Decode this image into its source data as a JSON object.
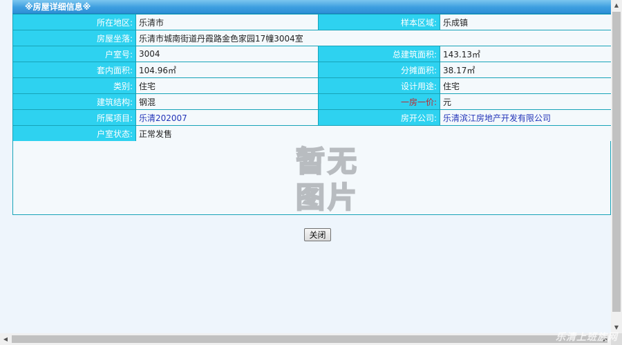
{
  "panel_title": "※房屋详细信息※",
  "rows": [
    {
      "label1": "所在地区:",
      "value1": "乐清市",
      "label2": "样本区域:",
      "value2": "乐成镇"
    },
    {
      "label1": "房屋坐落:",
      "value1": "乐清市城南街道丹霞路金色家园17幢3004室"
    },
    {
      "label1": "户室号:",
      "value1": "3004",
      "label2": "总建筑面积:",
      "value2": "143.13㎡"
    },
    {
      "label1": "套内面积:",
      "value1": "104.96㎡",
      "label2": "分摊面积:",
      "value2": "38.17㎡"
    },
    {
      "label1": "类别:",
      "value1": "住宅",
      "label2": "设计用途:",
      "value2": "住宅"
    },
    {
      "label1": "建筑结构:",
      "value1": "钢混",
      "label2": "一房一价:",
      "value2": "元"
    },
    {
      "label1": "所属项目:",
      "value1": "乐清202007",
      "label2": "房开公司:",
      "value2": "乐清滨江房地产开发有限公司"
    },
    {
      "label1": "户室状态:",
      "value1": "正常发售"
    }
  ],
  "no_image": {
    "line1": "暂无",
    "line2": "图片"
  },
  "close_label": "关闭",
  "watermark": "乐清上班族网",
  "colors": {
    "label_bg": "#2ed2f0",
    "title_bg": "#3d9fe0",
    "border": "#17a3b8",
    "price_label": "#c0282e",
    "link": "#2234b8"
  }
}
